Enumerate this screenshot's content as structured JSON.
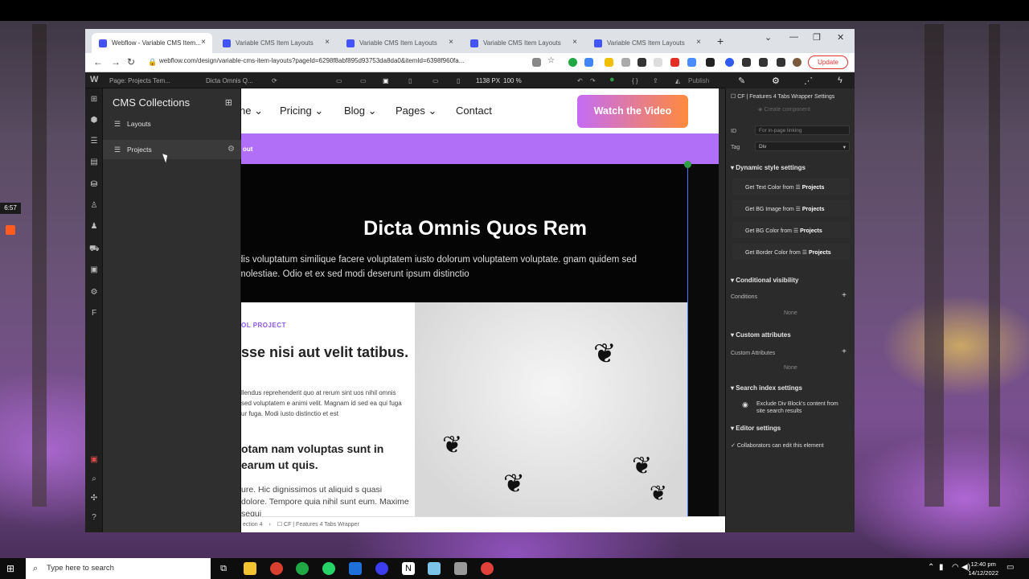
{
  "recording": {
    "time": "6:57"
  },
  "browser": {
    "tabs": [
      {
        "label": "Webflow - Variable CMS Item..."
      },
      {
        "label": "Variable CMS Item Layouts"
      },
      {
        "label": "Variable CMS Item Layouts"
      },
      {
        "label": "Variable CMS Item Layouts"
      },
      {
        "label": "Variable CMS Item Layouts"
      }
    ],
    "url": "webflow.com/design/variable-cms-item-layouts?pageId=6298f8abf895d93753da8da0&itemId=6398f960fa...",
    "update_label": "Update"
  },
  "designer": {
    "topbar": {
      "page": "Page: Projects Tem...",
      "item": "Dicta Omnis Q...",
      "width": "1138 PX",
      "zoom": "100 %",
      "publish": "Publish"
    },
    "cms": {
      "title": "CMS Collections",
      "collections": [
        {
          "label": "Layouts"
        },
        {
          "label": "Projects"
        }
      ]
    },
    "canvas": {
      "nav": [
        "ne",
        "Pricing",
        "Blog",
        "Pages",
        "Contact"
      ],
      "cta": "Watch the Video",
      "banner": "out",
      "hero_title": "Dicta Omnis Quos Rem",
      "hero_sub": "dis voluptatum similique facere voluptatem iusto dolorum voluptatem voluptate. gnam quidem sed molestiae. Odio et ex sed modi deserunt ipsum distinctio",
      "label": "OL PROJECT",
      "heading1": "sse nisi aut velit tatibus.",
      "para1": "llendus reprehenderit quo at rerum sint uos nihil omnis sed voluptatem e animi velit. Magnam id sed ea qui fuga ur fuga. Modi iusto distinctio et est",
      "heading2": "otam nam voluptas sunt in earum ut quis.",
      "para2": "ure. Hic dignissimos ut aliquid s quasi dolore. Tempore quia nihil sunt eum. Maxime sequi"
    },
    "breadcrumb": [
      "ection 4",
      "CF | Features 4 Tabs Wrapper"
    ],
    "settings": {
      "element": "CF | Features 4 Tabs Wrapper Settings",
      "create_component": "Create component",
      "id_label": "ID",
      "id_placeholder": "For in-page linking",
      "tag_label": "Tag",
      "tag_value": "Div",
      "dynamic_title": "Dynamic style settings",
      "dynamic_rows": [
        {
          "label": "Get Text Color from",
          "source": "Projects"
        },
        {
          "label": "Get BG Image from",
          "source": "Projects"
        },
        {
          "label": "Get BG Color from",
          "source": "Projects"
        },
        {
          "label": "Get Border Color from",
          "source": "Projects"
        }
      ],
      "visibility_title": "Conditional visibility",
      "conditions_label": "Conditions",
      "conditions_value": "None",
      "attributes_title": "Custom attributes",
      "attributes_label": "Custom Attributes",
      "attributes_value": "None",
      "search_title": "Search index settings",
      "search_option": "Exclude Div Block's content from site search results",
      "editor_title": "Editor settings",
      "editor_option": "Collaborators can edit this element"
    }
  },
  "taskbar": {
    "search_placeholder": "Type here to search",
    "time": "12:40 pm",
    "date": "14/12/2022"
  }
}
